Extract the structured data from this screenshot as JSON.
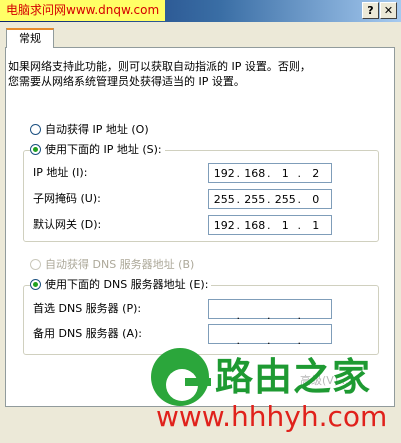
{
  "watermark_top": "电脑求问网www.dnqw.com",
  "titlebar": {
    "help": "?",
    "close": "✕"
  },
  "tabs": [
    {
      "label": "常规"
    }
  ],
  "intro_text": "如果网络支持此功能，则可以获取自动指派的 IP 设置。否则，\n您需要从网络系统管理员处获得适当的 IP 设置。",
  "ip_mode": {
    "auto_label": "自动获得 IP 地址 (O)",
    "manual_label": "使用下面的 IP 地址 (S):",
    "selected": "manual"
  },
  "ip_fields": [
    {
      "label": "IP 地址 (I):",
      "octets": [
        "192",
        "168",
        "1",
        "2"
      ]
    },
    {
      "label": "子网掩码 (U):",
      "octets": [
        "255",
        "255",
        "255",
        "0"
      ]
    },
    {
      "label": "默认网关 (D):",
      "octets": [
        "192",
        "168",
        "1",
        "1"
      ]
    }
  ],
  "dns_mode": {
    "auto_label": "自动获得 DNS 服务器地址 (B)",
    "auto_disabled": true,
    "manual_label": "使用下面的 DNS 服务器地址 (E):",
    "selected": "manual"
  },
  "dns_fields": [
    {
      "label": "首选 DNS 服务器 (P):",
      "octets": [
        "",
        "",
        "",
        ""
      ]
    },
    {
      "label": "备用 DNS 服务器 (A):",
      "octets": [
        "",
        "",
        "",
        ""
      ]
    }
  ],
  "advanced_button": "高级(V)...",
  "logo": {
    "name": "路由之家",
    "url": "www.hhhyh.com",
    "icon": "logo-e-icon"
  }
}
